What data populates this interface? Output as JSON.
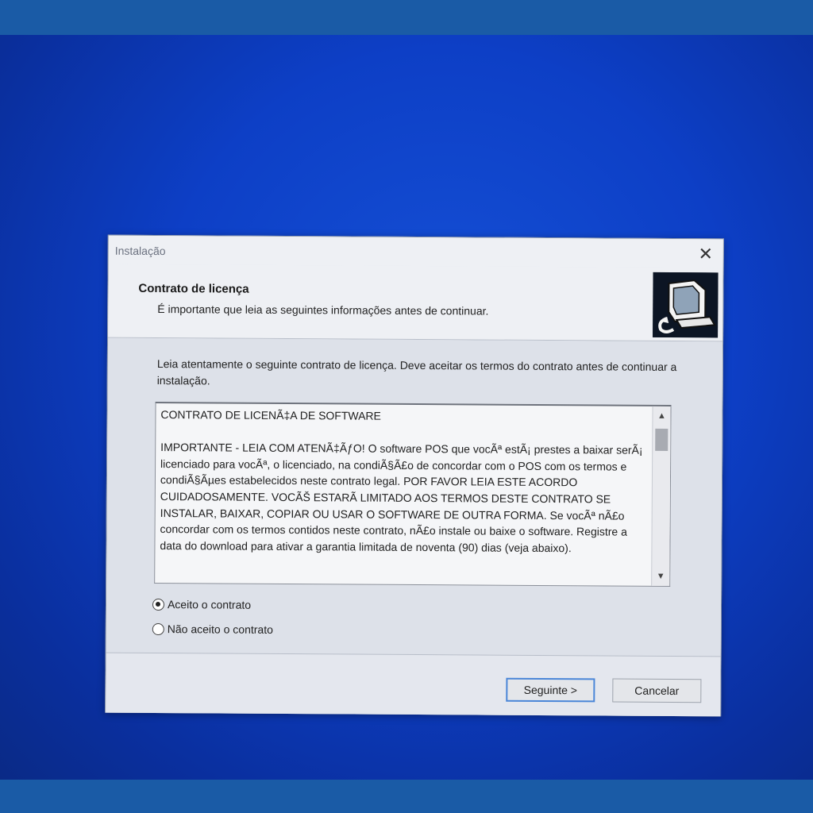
{
  "dialog": {
    "title": "Instalação",
    "close_label": "✕",
    "header": {
      "title": "Contrato de licença",
      "subtitle": "É importante que leia as seguintes informações antes de continuar."
    },
    "intro_text": "Leia atentamente o seguinte contrato de licença. Deve aceitar os termos do contrato antes de continuar a instalação.",
    "license_text": "CONTRATO DE LICENÃ‡A DE SOFTWARE\n\nIMPORTANTE - LEIA COM ATENÃ‡ÃƒO! O software POS que vocÃª estÃ¡ prestes a baixar serÃ¡ licenciado para vocÃª, o licenciado, na condiÃ§Ã£o de concordar com o POS com os termos e condiÃ§Ãµes estabelecidos neste contrato legal. POR FAVOR LEIA ESTE ACORDO CUIDADOSAMENTE. VOCÃŠ ESTARÃ    LIMITADO AOS TERMOS DESTE CONTRATO SE INSTALAR, BAIXAR, COPIAR OU USAR O SOFTWARE DE OUTRA FORMA. Se vocÃª nÃ£o concordar com os termos contidos neste contrato, nÃ£o instale ou baixe o software. Registre a data do download para ativar a garantia limitada de noventa (90) dias (veja abaixo).",
    "scroll_up": "▲",
    "scroll_down": "▼",
    "radio_accept": "Aceito o contrato",
    "radio_decline": "Não aceito o contrato",
    "selected": "accept",
    "next_label": "Seguinte >",
    "cancel_label": "Cancelar"
  },
  "colors": {
    "desktop": "#0d3fc6",
    "focus_border": "#4a86d8",
    "frame_band": "#1a5ba6"
  }
}
